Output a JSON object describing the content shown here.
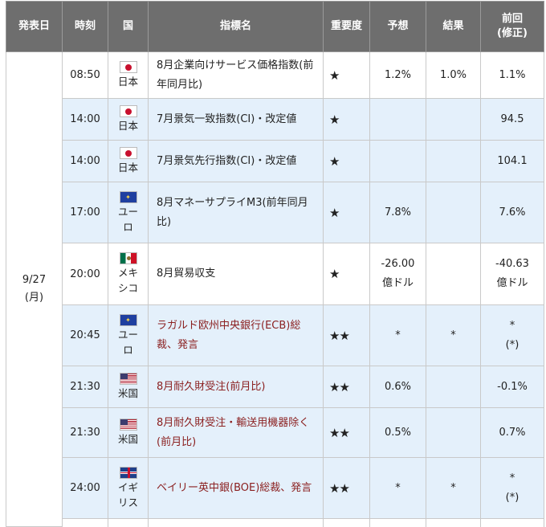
{
  "headers": {
    "date": "発表日",
    "time": "時刻",
    "country": "国",
    "indicator": "指標名",
    "importance": "重要度",
    "forecast": "予想",
    "result": "結果",
    "previous_line1": "前回",
    "previous_line2": "(修正)"
  },
  "date": {
    "day": "9/27",
    "weekday": "(月)"
  },
  "rows": [
    {
      "time": "08:50",
      "flag": "japan-flag-icon",
      "country": [
        "日本"
      ],
      "name": "8月企業向けサービス価格指数(前年同月比)",
      "stars": "★",
      "forecast": "1.2%",
      "result": "1.0%",
      "previous": "1.1%",
      "previous_note": ""
    },
    {
      "time": "14:00",
      "flag": "japan-flag-icon",
      "country": [
        "日本"
      ],
      "name": "7月景気一致指数(CI)・改定値",
      "stars": "★",
      "forecast": "",
      "result": "",
      "previous": "94.5",
      "previous_note": ""
    },
    {
      "time": "14:00",
      "flag": "japan-flag-icon",
      "country": [
        "日本"
      ],
      "name": "7月景気先行指数(CI)・改定値",
      "stars": "★",
      "forecast": "",
      "result": "",
      "previous": "104.1",
      "previous_note": ""
    },
    {
      "time": "17:00",
      "flag": "eu-flag-icon",
      "country": [
        "ユー",
        "ロ"
      ],
      "name": "8月マネーサプライM3(前年同月比)",
      "stars": "★",
      "forecast": "7.8%",
      "result": "",
      "previous": "7.6%",
      "previous_note": ""
    },
    {
      "time": "20:00",
      "flag": "mexico-flag-icon",
      "country": [
        "メキ",
        "シコ"
      ],
      "name": "8月貿易収支",
      "stars": "★",
      "forecast": "-26.00",
      "forecast_unit": "億ドル",
      "result": "",
      "previous": "-40.63",
      "previous_note": "億ドル"
    },
    {
      "time": "20:45",
      "flag": "eu-flag-icon",
      "country": [
        "ユー",
        "ロ"
      ],
      "name": "ラガルド欧州中央銀行(ECB)総裁、発言",
      "stars": "★★",
      "forecast": "*",
      "result": "*",
      "previous": "*",
      "previous_note": "(*)"
    },
    {
      "time": "21:30",
      "flag": "us-flag-icon",
      "country": [
        "米国"
      ],
      "name": "8月耐久財受注(前月比)",
      "stars": "★★",
      "forecast": "0.6%",
      "result": "",
      "previous": "-0.1%",
      "previous_note": ""
    },
    {
      "time": "21:30",
      "flag": "us-flag-icon",
      "country": [
        "米国"
      ],
      "name": "8月耐久財受注・輸送用機器除く(前月比)",
      "stars": "★★",
      "forecast": "0.5%",
      "result": "",
      "previous": "0.7%",
      "previous_note": ""
    },
    {
      "time": "24:00",
      "flag": "uk-flag-icon",
      "country": [
        "イギ",
        "リス"
      ],
      "name": "ベイリー英中銀(BOE)総裁、発言",
      "stars": "★★",
      "forecast": "*",
      "result": "*",
      "previous": "*",
      "previous_note": "(*)"
    }
  ],
  "colors": {
    "header_bg": "#6e6e6e",
    "row_blue": "#e4f0fb",
    "link_red": "#8b2020"
  }
}
